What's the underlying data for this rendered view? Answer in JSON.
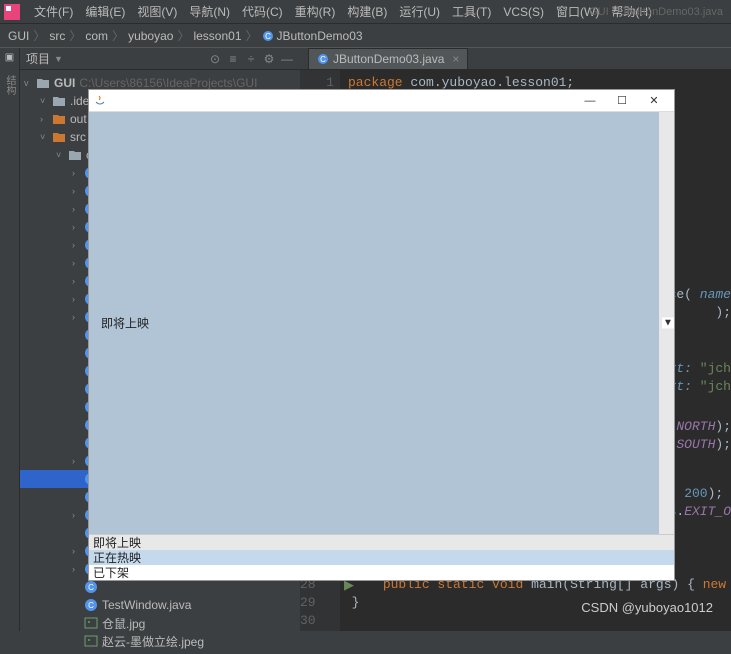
{
  "menubar": {
    "items": [
      "文件(F)",
      "编辑(E)",
      "视图(V)",
      "导航(N)",
      "代码(C)",
      "重构(R)",
      "构建(B)",
      "运行(U)",
      "工具(T)",
      "VCS(S)",
      "窗口(W)",
      "帮助(H)"
    ],
    "project_label": "GUI – JButtonDemo03.java"
  },
  "breadcrumb": {
    "parts": [
      "GUI",
      "src",
      "com",
      "yuboyao",
      "lesson01",
      "JButtonDemo03"
    ]
  },
  "project_panel": {
    "title": "项目",
    "root": {
      "name": "GUI",
      "path": "C:\\Users\\86156\\IdeaProjects\\GUI"
    },
    "nodes": [
      {
        "depth": 1,
        "arrow": "v",
        "icon": "folder",
        "label": ".idea",
        "truncated": ".ide"
      },
      {
        "depth": 1,
        "arrow": ">",
        "icon": "folder-orange",
        "label": "out"
      },
      {
        "depth": 1,
        "arrow": "v",
        "icon": "folder-orange",
        "label": "src"
      },
      {
        "depth": 2,
        "arrow": "v",
        "icon": "folder",
        "label": "c"
      },
      {
        "depth": 3,
        "arrow": ">",
        "icon": "java",
        "label": ""
      },
      {
        "depth": 3,
        "arrow": ">",
        "icon": "java",
        "label": ""
      },
      {
        "depth": 3,
        "arrow": ">",
        "icon": "java",
        "label": ""
      },
      {
        "depth": 3,
        "arrow": ">",
        "icon": "java",
        "label": ""
      },
      {
        "depth": 3,
        "arrow": ">",
        "icon": "java",
        "label": ""
      },
      {
        "depth": 3,
        "arrow": ">",
        "icon": "java",
        "label": ""
      },
      {
        "depth": 3,
        "arrow": ">",
        "icon": "java",
        "label": ""
      },
      {
        "depth": 3,
        "arrow": ">",
        "icon": "java",
        "label": ""
      },
      {
        "depth": 3,
        "arrow": ">",
        "icon": "java",
        "label": ""
      },
      {
        "depth": 3,
        "arrow": "",
        "icon": "java",
        "label": ""
      },
      {
        "depth": 3,
        "arrow": "",
        "icon": "java",
        "label": ""
      },
      {
        "depth": 3,
        "arrow": "",
        "icon": "java",
        "label": ""
      },
      {
        "depth": 3,
        "arrow": "",
        "icon": "java",
        "label": ""
      },
      {
        "depth": 3,
        "arrow": "",
        "icon": "java",
        "label": ""
      },
      {
        "depth": 3,
        "arrow": "",
        "icon": "java",
        "label": ""
      },
      {
        "depth": 3,
        "arrow": "",
        "icon": "java",
        "label": ""
      },
      {
        "depth": 3,
        "arrow": ">",
        "icon": "java",
        "label": ""
      },
      {
        "depth": 3,
        "arrow": "",
        "icon": "java",
        "label": "",
        "selected": true
      },
      {
        "depth": 3,
        "arrow": "",
        "icon": "java",
        "label": ""
      },
      {
        "depth": 3,
        "arrow": ">",
        "icon": "java",
        "label": ""
      },
      {
        "depth": 3,
        "arrow": "",
        "icon": "java",
        "label": ""
      },
      {
        "depth": 3,
        "arrow": ">",
        "icon": "java",
        "label": ""
      },
      {
        "depth": 3,
        "arrow": ">",
        "icon": "java",
        "label": ""
      },
      {
        "depth": 3,
        "arrow": "",
        "icon": "java",
        "label": ""
      },
      {
        "depth": 3,
        "arrow": "",
        "icon": "java",
        "label": "TestWindow.java"
      },
      {
        "depth": 3,
        "arrow": "",
        "icon": "img",
        "label": "仓鼠.jpg"
      },
      {
        "depth": 3,
        "arrow": "",
        "icon": "img",
        "label": "赵云-墨做立绘.jpeg"
      }
    ]
  },
  "tabs": {
    "active": "JButtonDemo03.java"
  },
  "editor_fragments": {
    "line1": "package com.yuboyao.lesson01;",
    "ln1": "1",
    "rce": "rce( name",
    "paren": ");",
    "text_l": "text:",
    "str_jch": "\"jch",
    "north": "NORTH",
    "south": "SOUTH",
    "two_h": "200",
    "exit": "s.EXIT_O",
    "main_sig": "public static void main(String[] args) { new JButto",
    "brace": "}",
    "ln28": "28",
    "ln29": "29",
    "ln30": "30"
  },
  "java_window": {
    "center_label": "即将上映",
    "combo_selected": "即将上映",
    "combo_options": [
      "即将上映",
      "正在热映",
      "已下架"
    ]
  },
  "watermark": "CSDN @yuboyao1012"
}
